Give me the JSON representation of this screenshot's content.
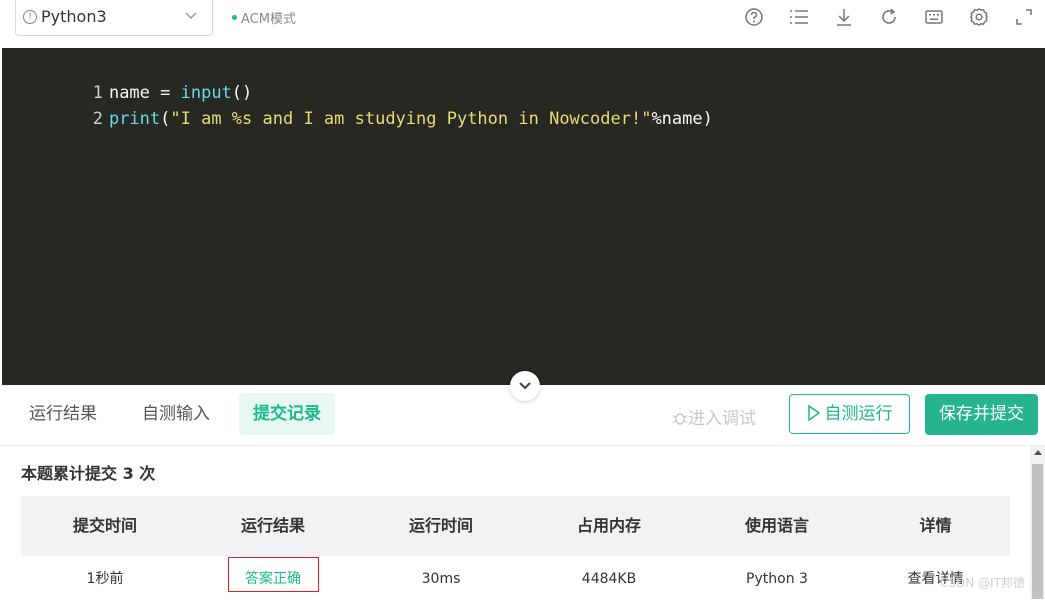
{
  "toolbar": {
    "language": "Python3",
    "mode": "ACM模式",
    "icons": [
      "help-icon",
      "list-icon",
      "download-icon",
      "refresh-icon",
      "keyboard-icon",
      "gear-icon",
      "expand-icon"
    ]
  },
  "editor": {
    "lines": [
      {
        "num": "1",
        "t1": "name = ",
        "t2": "input",
        "t3": "()"
      },
      {
        "num": "2",
        "t1": "print",
        "t2": "(",
        "t3": "\"I am %s and I am studying Python in Nowcoder!\"",
        "t4": "%name)"
      }
    ]
  },
  "tabs": {
    "result": "运行结果",
    "custom_input": "自测输入",
    "submissions": "提交记录"
  },
  "actions": {
    "debug": "进入调试",
    "run": "自测运行",
    "submit": "保存并提交"
  },
  "submissions": {
    "count_text": "本题累计提交 3 次",
    "headers": [
      "提交时间",
      "运行结果",
      "运行时间",
      "占用内存",
      "使用语言",
      "详情"
    ],
    "rows": [
      [
        "1秒前",
        "答案正确",
        "30ms",
        "4484KB",
        "Python 3",
        "查看详情"
      ]
    ]
  },
  "watermark": "CSDN @IT邦德",
  "colors": {
    "accent": "#1bba8a",
    "editor_bg": "#272822",
    "highlight_border": "#e02020"
  }
}
